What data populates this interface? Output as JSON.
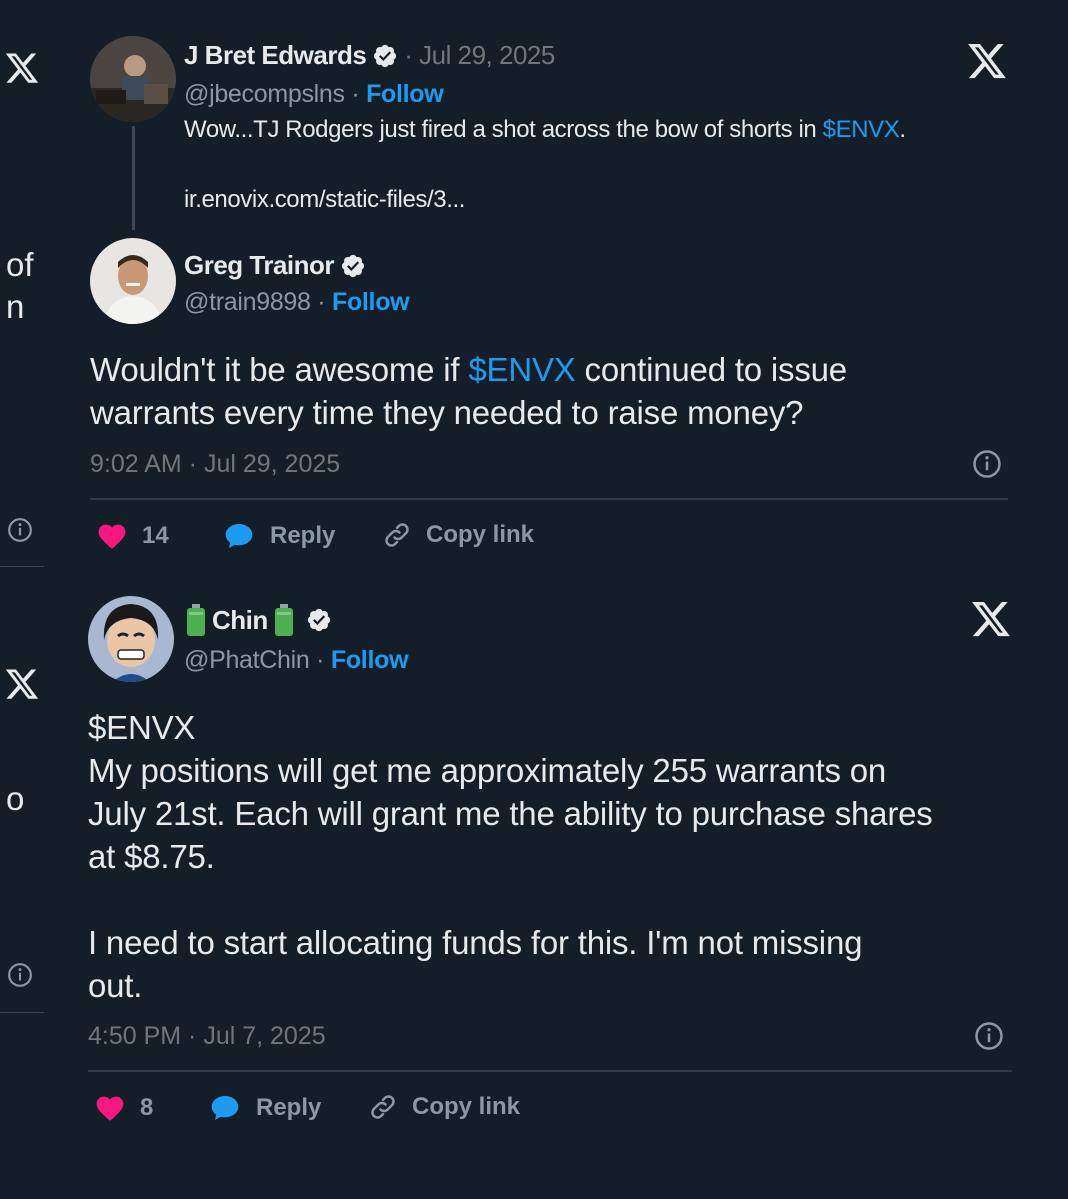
{
  "left_fragments": {
    "frag_of": "of",
    "frag_n": "n",
    "frag_o": "o"
  },
  "card1": {
    "quoted": {
      "name": "J Bret Edwards",
      "date": "· Jul 29, 2025",
      "handle": "@jbecompslns",
      "sep": " · ",
      "follow": "Follow",
      "text_before": "Wow...TJ Rodgers just fired a shot across the bow of shorts in ",
      "cashtag": "$ENVX",
      "text_after": ".",
      "url": "ir.enovix.com/static-files/3..."
    },
    "reply": {
      "name": "Greg Trainor",
      "handle": "@train9898",
      "sep": " · ",
      "follow": "Follow",
      "text_before": "Wouldn't it be awesome if ",
      "cashtag": "$ENVX",
      "text_after": " continued to issue\nwarrants every time they needed to raise money?",
      "timestamp": "9:02 AM · Jul 29, 2025"
    },
    "actions": {
      "likes": "14",
      "reply": "Reply",
      "copy_link": "Copy link"
    }
  },
  "card2": {
    "name": "Chin",
    "handle": "@PhatChin",
    "sep": " · ",
    "follow": "Follow",
    "cashtag": "$ENVX",
    "body": "My positions will get me approximately 255 warrants on\nJuly 21st. Each will grant me the ability to purchase shares\nat $8.75.\n\nI need to start allocating funds for this. I'm not missing\nout.",
    "timestamp": "4:50 PM · Jul 7, 2025",
    "actions": {
      "likes": "8",
      "reply": "Reply",
      "copy_link": "Copy link"
    }
  },
  "colors": {
    "background": "#141e28",
    "accent": "#1d9bf0",
    "like": "#f91880",
    "battery": "#4caf50"
  }
}
